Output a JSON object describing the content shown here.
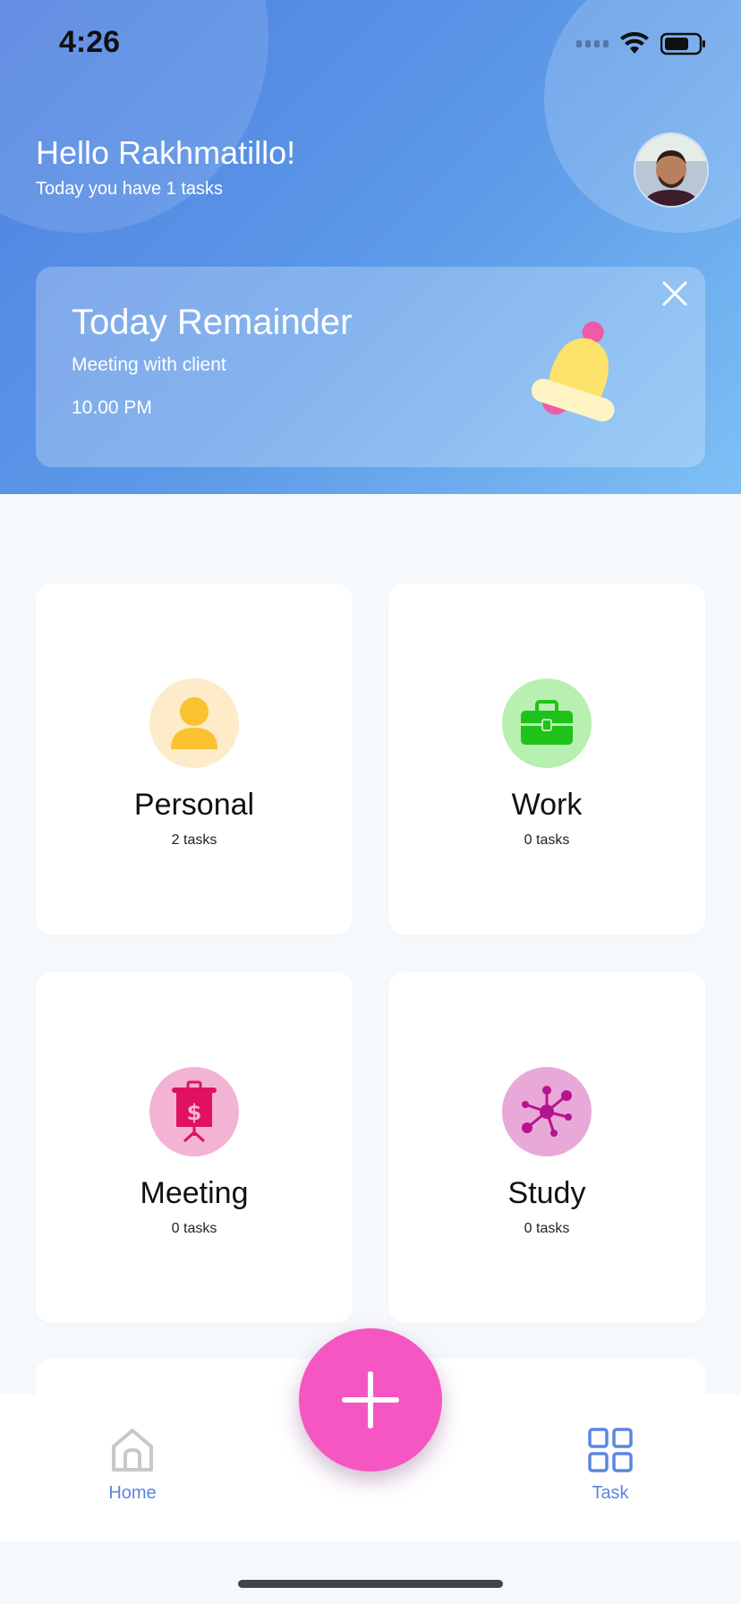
{
  "status_bar": {
    "time": "4:26"
  },
  "header": {
    "greeting": "Hello Rakhmatillo!",
    "subtitle": "Today you have 1 tasks"
  },
  "reminder": {
    "title": "Today Remainder",
    "description": "Meeting with client",
    "time": "10.00 PM"
  },
  "categories": [
    {
      "name": "Personal",
      "count": "2 tasks",
      "icon": "person-icon",
      "bg": "#fdebc9",
      "color": "#f9c22e"
    },
    {
      "name": "Work",
      "count": "0 tasks",
      "icon": "briefcase-icon",
      "bg": "#b7f0b0",
      "color": "#1fc21a"
    },
    {
      "name": "Meeting",
      "count": "0 tasks",
      "icon": "presentation-icon",
      "bg": "#f3b3d4",
      "color": "#e0115f"
    },
    {
      "name": "Study",
      "count": "0 tasks",
      "icon": "molecule-icon",
      "bg": "#e8a9d8",
      "color": "#b5148f"
    }
  ],
  "nav": {
    "home_label": "Home",
    "task_label": "Task"
  },
  "colors": {
    "accent": "#5a86e0",
    "fab": "#f556c2"
  }
}
